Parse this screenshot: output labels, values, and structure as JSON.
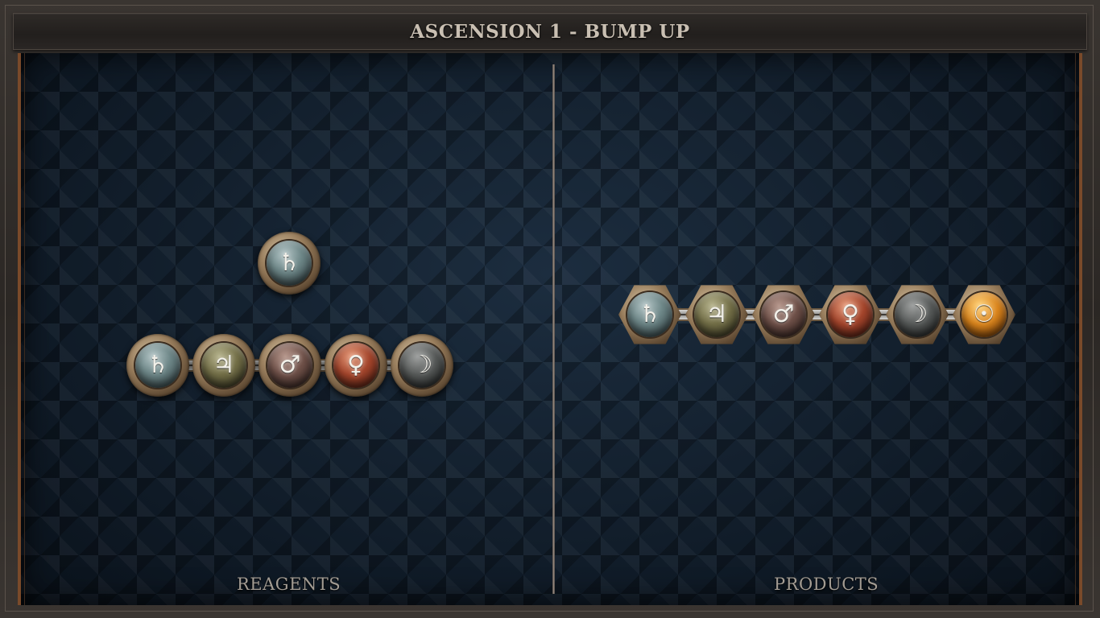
{
  "header": {
    "title": "ASCENSION 1 - BUMP UP"
  },
  "panels": {
    "reagents_label": "REAGENTS",
    "products_label": "PRODUCTS"
  },
  "reagents": {
    "single_atom": {
      "element": "lead",
      "symbol": "♄"
    },
    "chain": [
      {
        "element": "lead",
        "symbol": "♄"
      },
      {
        "element": "tin",
        "symbol": "♃"
      },
      {
        "element": "iron",
        "symbol": "♂"
      },
      {
        "element": "copper",
        "symbol": "♀"
      },
      {
        "element": "silver",
        "symbol": "☽"
      }
    ]
  },
  "products": {
    "chain": [
      {
        "element": "lead",
        "symbol": "♄"
      },
      {
        "element": "tin",
        "symbol": "♃"
      },
      {
        "element": "iron",
        "symbol": "♂"
      },
      {
        "element": "copper",
        "symbol": "♀"
      },
      {
        "element": "silver",
        "symbol": "☽"
      },
      {
        "element": "gold",
        "symbol": "☉"
      }
    ]
  },
  "colors": {
    "board_background": "#0f1a26",
    "frame_accent": "#7a4a2a",
    "title_text": "#c9bfb2",
    "label_text": "#a39c93"
  }
}
